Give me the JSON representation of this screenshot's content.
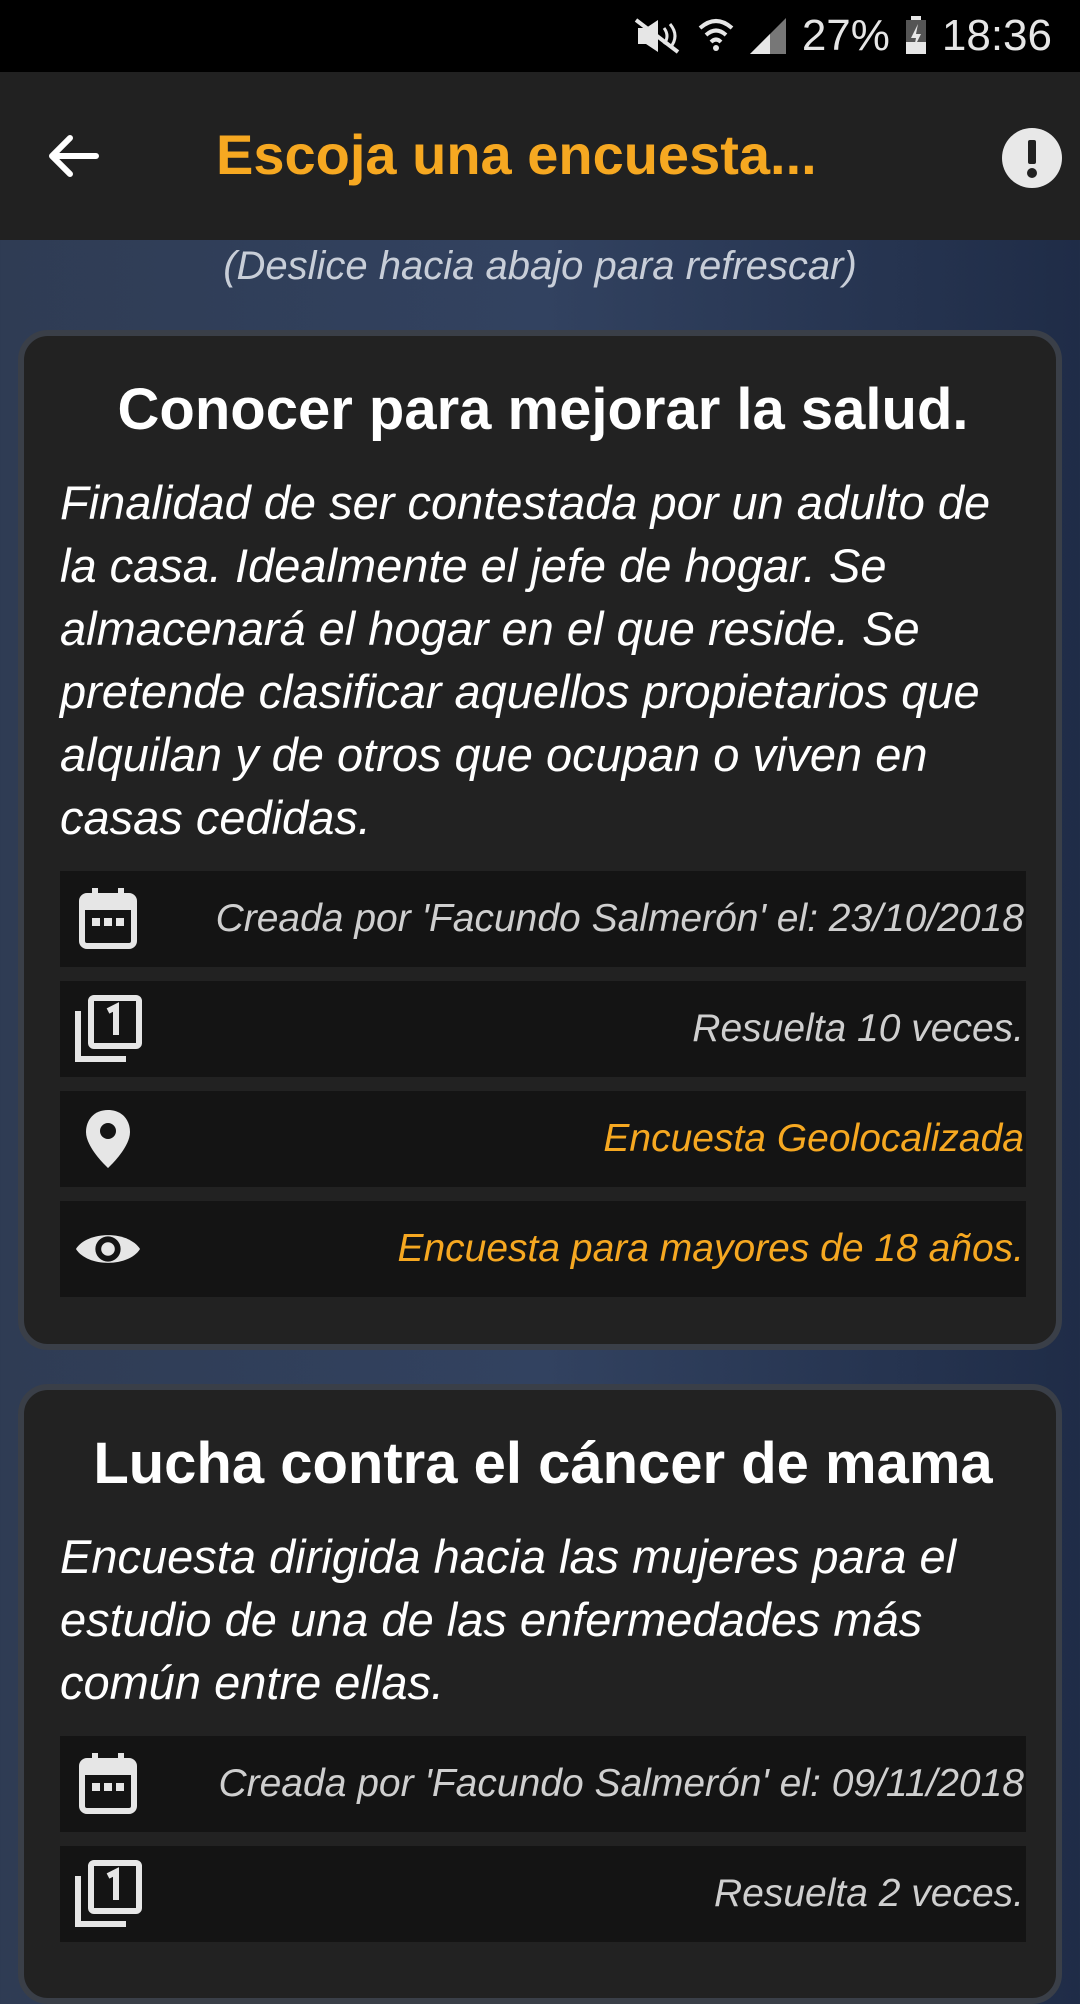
{
  "status_bar": {
    "battery": "27%",
    "time": "18:36"
  },
  "header": {
    "title": "Escoja una encuesta..."
  },
  "hint": "(Deslice hacia abajo para refrescar)",
  "surveys": [
    {
      "title": "Conocer para mejorar la salud.",
      "description": "Finalidad de ser contestada por un adulto de la casa. Idealmente el jefe de hogar. Se almacenará el hogar en el que reside. Se pretende clasificar aquellos propietarios que alquilan y de otros que ocupan o viven en casas cedidas.",
      "created": "Creada por 'Facundo Salmerón' el: 23/10/2018",
      "resolved": "Resuelta 10 veces.",
      "geo": "Encuesta Geolocalizada",
      "age": "Encuesta para mayores de 18 años."
    },
    {
      "title": "Lucha contra el cáncer de mama",
      "description": "Encuesta dirigida hacia las mujeres para el estudio de una de las enfermedades más común entre ellas.",
      "created": "Creada por 'Facundo Salmerón' el: 09/11/2018",
      "resolved": "Resuelta 2 veces."
    }
  ],
  "icons": [
    "mute-icon",
    "wifi-icon",
    "signal-icon",
    "battery-icon",
    "back-arrow-icon",
    "info-icon",
    "calendar-icon",
    "counter-icon",
    "location-pin-icon",
    "eye-icon"
  ],
  "colors": {
    "accent": "#f6a821",
    "appbar": "#212121",
    "card": "#222222"
  }
}
